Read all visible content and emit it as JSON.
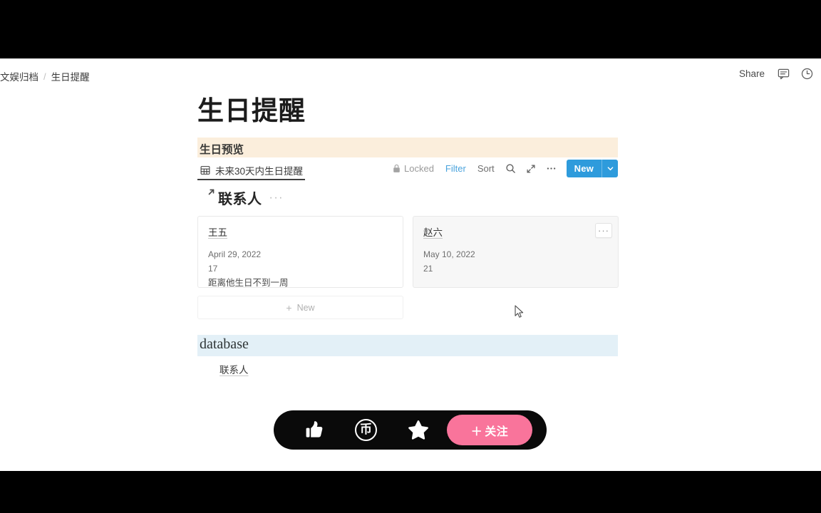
{
  "topbar": {
    "breadcrumb": {
      "parent": "文娱归档",
      "separator": "/",
      "current": "生日提醒"
    },
    "share_label": "Share",
    "comment_icon": "comment-icon",
    "history_icon": "clock-history-icon"
  },
  "page": {
    "title": "生日提醒",
    "callout_cream": "生日预览",
    "callout_blue": "database",
    "colors": {
      "cream_highlight": "#FBEEDC",
      "blue_highlight": "#E3F0F7",
      "accent_blue": "#2E9BDC",
      "filter_blue": "#4AA3DD",
      "follow_pink": "#F9749B",
      "bar_black": "#0A0A0A"
    }
  },
  "database_toolbar": {
    "tab": {
      "icon": "table-grid-icon",
      "label": "未来30天内生日提醒",
      "active": true
    },
    "locked_label": "Locked",
    "lock_icon": "lock-icon",
    "filter_label": "Filter",
    "sort_label": "Sort",
    "search_icon": "search-icon",
    "expand_icon": "expand-arrows-icon",
    "more_icon": "ellipsis-icon",
    "new_button": {
      "label": "New",
      "caret_icon": "chevron-down-icon"
    }
  },
  "gallery": {
    "icon": "card-index-linked-icon",
    "title": "联系人",
    "more_icon": "ellipsis-icon",
    "cards": [
      {
        "name": "王五",
        "date": "April 29, 2022",
        "number": "17",
        "note": "距离他生日不到一周",
        "hovered": false
      },
      {
        "name": "赵六",
        "date": "May 10, 2022",
        "number": "21",
        "note": "",
        "hovered": true,
        "more_icon": "ellipsis-icon"
      }
    ],
    "new_row": {
      "plus": "+",
      "label": "New"
    }
  },
  "database_section": {
    "heading": "database",
    "link": {
      "icon": "card-index-icon",
      "label": "联系人"
    }
  },
  "action_bar": {
    "like_icon": "thumbs-up-icon",
    "coin_icon": "coin-icon",
    "coin_glyph": "币",
    "favorite_icon": "star-icon",
    "follow_button": {
      "plus": "＋",
      "label": "关注"
    }
  }
}
